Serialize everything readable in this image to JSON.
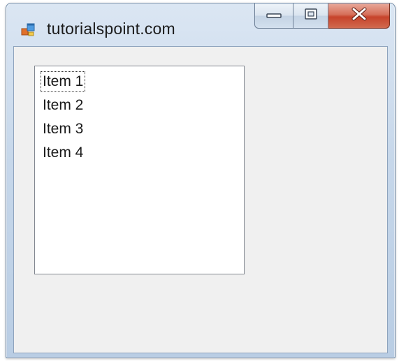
{
  "window": {
    "title": "tutorialspoint.com",
    "icon": "winforms-app-icon",
    "caption_buttons": [
      {
        "name": "minimize",
        "icon": "minimize-icon"
      },
      {
        "name": "maximize",
        "icon": "maximize-icon"
      },
      {
        "name": "close",
        "icon": "close-icon"
      }
    ]
  },
  "listbox": {
    "items": [
      "Item 1",
      "Item 2",
      "Item 3",
      "Item 4"
    ],
    "focused_index": 0
  },
  "colors": {
    "client_background": "#f0f0f0",
    "listbox_background": "#ffffff",
    "close_button": "#c7432b",
    "frame": "#c6d7ea"
  }
}
